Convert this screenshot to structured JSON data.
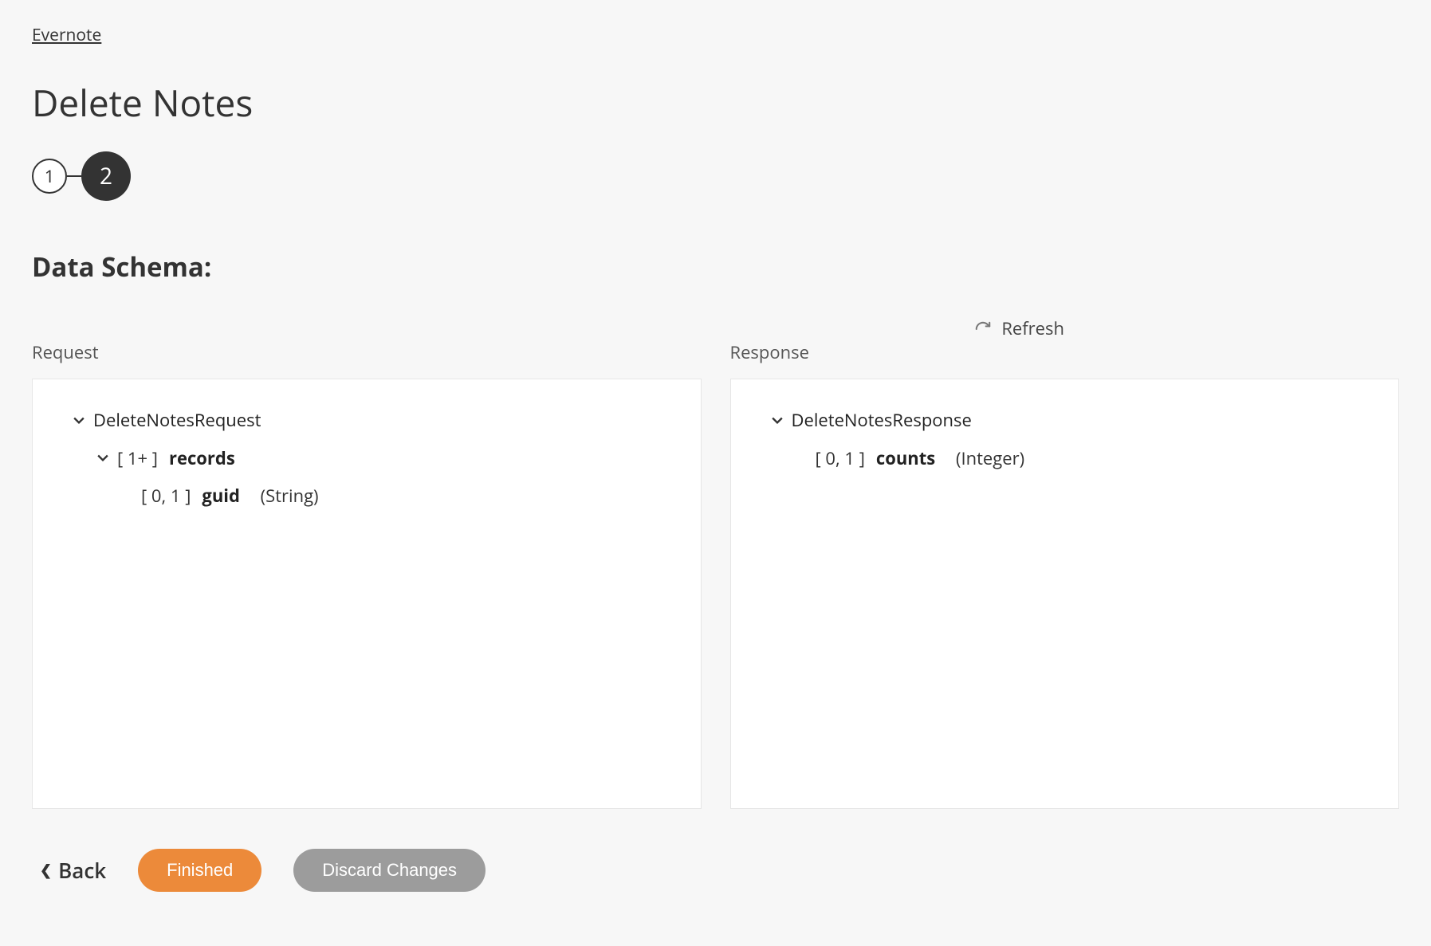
{
  "breadcrumb": {
    "label": "Evernote"
  },
  "page_title": "Delete Notes",
  "stepper": {
    "steps": [
      {
        "label": "1",
        "active": false
      },
      {
        "label": "2",
        "active": true
      }
    ]
  },
  "section_heading": "Data Schema:",
  "refresh": {
    "label": "Refresh"
  },
  "panels": {
    "request": {
      "label": "Request",
      "root_name": "DeleteNotesRequest",
      "field1_cardinality": "[ 1+ ]",
      "field1_name": "records",
      "field1_child_cardinality": "[ 0, 1 ]",
      "field1_child_name": "guid",
      "field1_child_type": "(String)"
    },
    "response": {
      "label": "Response",
      "root_name": "DeleteNotesResponse",
      "field1_cardinality": "[ 0, 1 ]",
      "field1_name": "counts",
      "field1_type": "(Integer)"
    }
  },
  "footer": {
    "back_label": "Back",
    "finished_label": "Finished",
    "discard_label": "Discard Changes"
  },
  "colors": {
    "accent": "#ec8a3a",
    "muted": "#9c9c9c",
    "stepper_active_bg": "#333333"
  }
}
